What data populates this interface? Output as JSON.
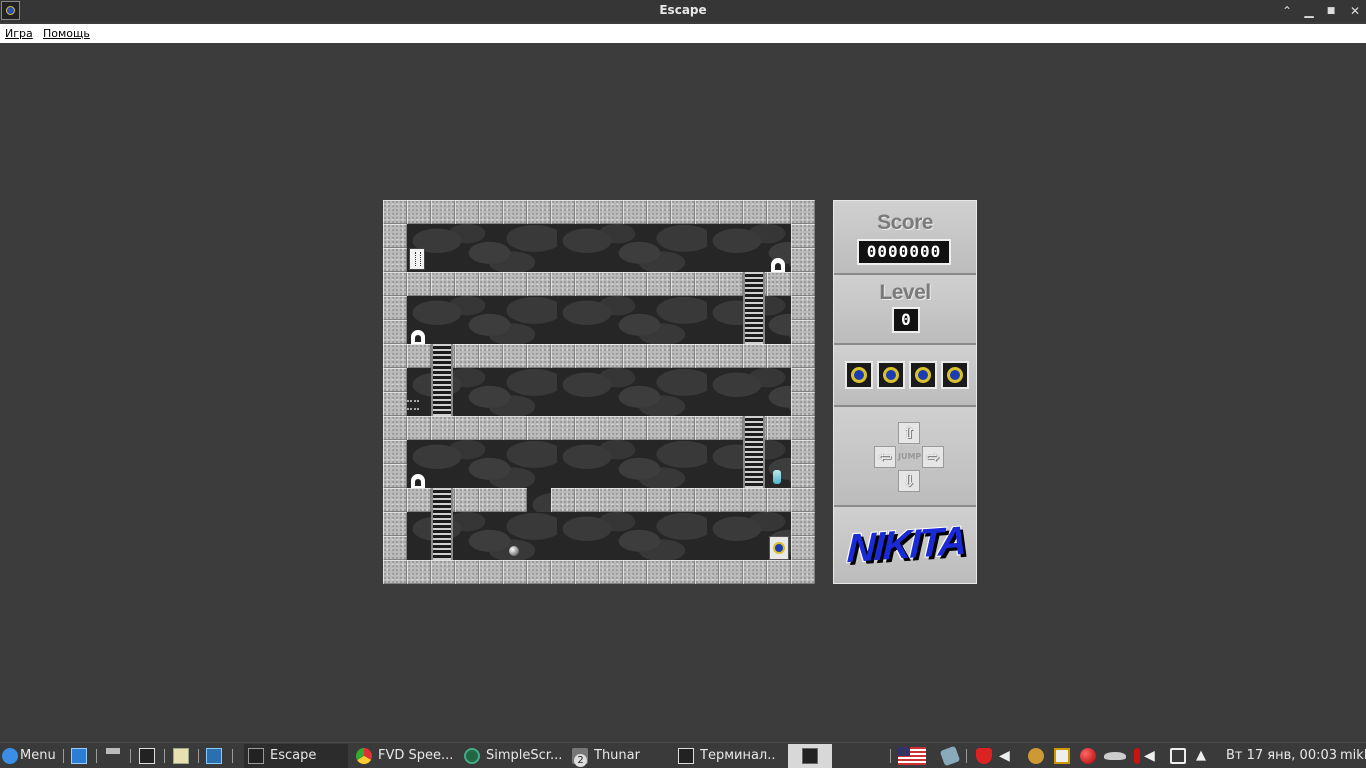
{
  "window": {
    "title": "Escape",
    "controls": {
      "minimize": "⌃",
      "restore": "▁",
      "maximize": "■",
      "close": "✕"
    }
  },
  "menu": {
    "items": [
      "Игра",
      "Помощь"
    ]
  },
  "game": {
    "hud": {
      "score_label": "Score",
      "score_value": "0000000",
      "level_label": "Level",
      "level_value": "0",
      "lives": 4,
      "controls": {
        "up": "⇧",
        "down": "⇩",
        "left": "⇦",
        "right": "⇨",
        "jump": "JUMP"
      },
      "logo": "NIKITA"
    }
  },
  "taskbar": {
    "menu_label": "Menu",
    "tasks": [
      {
        "label": "Escape",
        "icon": "game-icon",
        "active": true
      },
      {
        "label": "FVD Spee...",
        "icon": "chrome-icon"
      },
      {
        "label": "SimpleScr...",
        "icon": "simplescreenrecorder-icon"
      },
      {
        "label": "Thunar",
        "icon": "folder-icon",
        "badge": "2"
      },
      {
        "label": "Терминал...",
        "icon": "terminal-icon"
      }
    ],
    "clock": "Вт 17 янв, 00:03",
    "user": "mikl",
    "colors": {
      "accent": "#3a8ee6",
      "bg": "#3a3a3a"
    }
  }
}
